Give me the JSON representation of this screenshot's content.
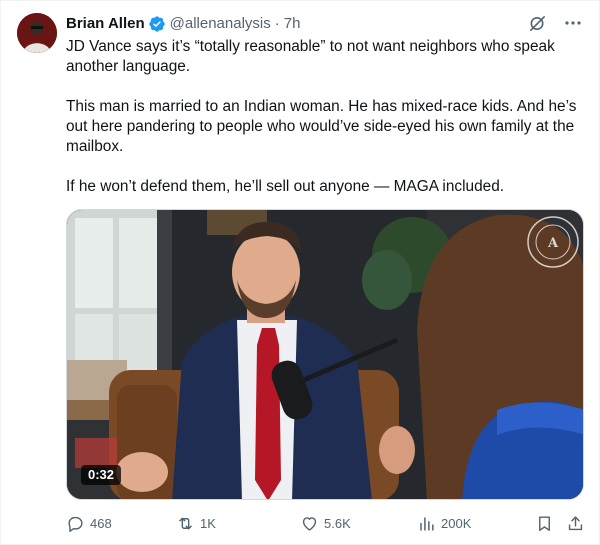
{
  "author": {
    "name": "Brian Allen",
    "handle": "@allenanalysis",
    "separator": "·",
    "time": "7h",
    "avatar_icon": "profile-avatar",
    "verified_icon": "verified-badge-icon"
  },
  "header_actions": {
    "grok_icon": "grok-icon",
    "more_icon": "more-horizontal-icon"
  },
  "tweet_text": {
    "p1": "JD Vance says it’s “totally reasonable” to not want neighbors who speak another language.",
    "p2": "This man is married to an Indian woman. He has mixed-race kids. And he’s out here pandering to people who would’ve side-eyed his own family at the mailbox.",
    "p3": "If he won’t defend them, he’ll sell out anyone — MAGA included."
  },
  "media": {
    "type": "video",
    "duration": "0:32",
    "watermark": "ALLEN ANALYSIS"
  },
  "actions": {
    "reply": {
      "count": "468",
      "icon": "reply-icon"
    },
    "retweet": {
      "count": "1K",
      "icon": "retweet-icon"
    },
    "like": {
      "count": "5.6K",
      "icon": "heart-icon"
    },
    "views": {
      "count": "200K",
      "icon": "views-icon"
    },
    "bookmark": {
      "icon": "bookmark-icon"
    },
    "share": {
      "icon": "share-icon"
    }
  },
  "colors": {
    "text_primary": "#0f1419",
    "text_secondary": "#536471",
    "verified_blue": "#1d9bf0",
    "border": "#cfd9de"
  }
}
